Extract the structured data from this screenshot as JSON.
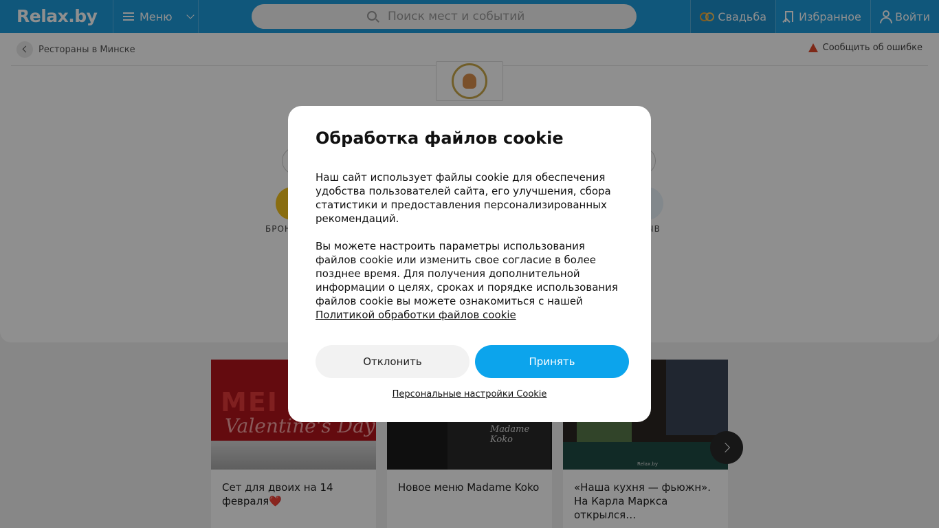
{
  "header": {
    "logo": "Relax.by",
    "menu_label": "Меню",
    "search_placeholder": "Поиск мест и событий",
    "wedding_label": "Свадьба",
    "favorites_label": "Избранное",
    "login_label": "Войти"
  },
  "breadcrumb": {
    "back_label": "Рестораны в Минске",
    "report_label": "Сообщить об ошибке"
  },
  "behind_actions": {
    "left_label": "БРОН",
    "right_label": "ЫВ"
  },
  "cards": [
    {
      "title": "Сет для двоих на 14 февраля❤️",
      "image_text_1": "MEI",
      "image_text_2": "Valentine's Day"
    },
    {
      "title": "Новое меню Madame Koko",
      "image_text": "Madame Koko"
    },
    {
      "title": "«Наша кухня — фьюжн». На Карла Маркса открылся…",
      "image_watermark": "Relax.by"
    }
  ],
  "cookie_modal": {
    "title": "Обработка файлов cookie",
    "paragraph_1": "Наш сайт использует файлы cookie для обеспечения удобства пользователей сайта, его улучшения, сбора статистики и предоставления персонализированных рекомендаций.",
    "paragraph_2": "Вы можете настроить параметры использования файлов cookie или изменить свое согласие в более позднее время. Для получения дополнительной информации о целях, сроках и порядке использования файлов cookie вы можете ознакомиться с нашей",
    "policy_link": "Политикой обработки файлов cookie",
    "decline_label": "Отклонить",
    "accept_label": "Принять",
    "settings_link": "Персональные настройки Cookie"
  },
  "colors": {
    "header_bg": "#1e9cdc",
    "accept_button": "#0ca4ec",
    "decline_button": "#f2f2f2"
  },
  "icons": [
    "search-icon",
    "menu-icon",
    "chevron-down-icon",
    "rings-icon",
    "bookmark-icon",
    "user-icon",
    "chevron-left-icon",
    "warning-icon",
    "chevron-right-icon"
  ]
}
